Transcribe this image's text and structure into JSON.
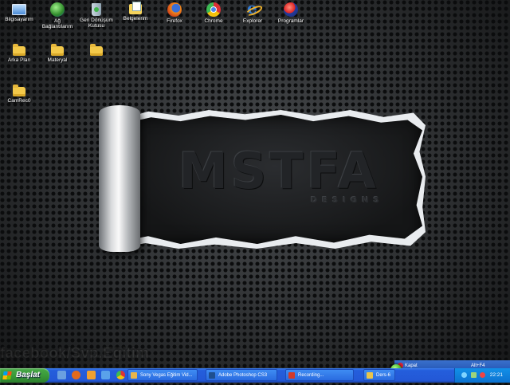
{
  "desktop": {
    "icons": [
      {
        "label": "Bilgisayarım",
        "icon": "my-computer-icon"
      },
      {
        "label": "Ağ Bağlantılarım",
        "icon": "network-icon"
      },
      {
        "label": "Geri Dönüşüm Kutusu",
        "icon": "recycle-bin-icon"
      },
      {
        "label": "Belgelerim",
        "icon": "my-documents-icon"
      },
      {
        "label": "Firefox",
        "icon": "firefox-icon"
      },
      {
        "label": "Chrome",
        "icon": "chrome-icon"
      },
      {
        "label": "Explorer",
        "icon": "internet-explorer-icon"
      },
      {
        "label": "Programlar",
        "icon": "programs-icon"
      },
      {
        "label": "Arka Plan",
        "icon": "folder-icon"
      },
      {
        "label": "Materyal",
        "icon": "folder-icon"
      },
      {
        "label": "",
        "icon": "folder-icon"
      },
      {
        "label": "CamRec0",
        "icon": "folder-icon"
      }
    ],
    "wallpaper": {
      "logo_text": "MSTFA",
      "logo_subtext": "DESIGNS"
    },
    "watermark": "facebook/Svp.Eğitim"
  },
  "recording_popup": {
    "close_label": "Kapat",
    "hotkey": "Alt+F4"
  },
  "taskbar": {
    "start_label": "Başlat",
    "quick_launch": [
      "desktop-icon",
      "firefox-icon",
      "media-player-icon",
      "ie-icon",
      "chrome-icon"
    ],
    "tasks": [
      {
        "label": "Sony Vegas Eğitim Vid...",
        "icon_color": "#e8b64a"
      },
      {
        "label": "Adobe Photoshop CS3",
        "icon_color": "#1e4f8f"
      },
      {
        "label": "Recording...",
        "icon_color": "#d23a2a"
      },
      {
        "label": "Ders-6",
        "icon_color": "#e8c44a"
      }
    ],
    "clock": "22:21"
  },
  "colors": {
    "taskbar_blue": "#245edc",
    "start_green": "#3a9a3a",
    "tray_blue": "#0c72d0"
  }
}
